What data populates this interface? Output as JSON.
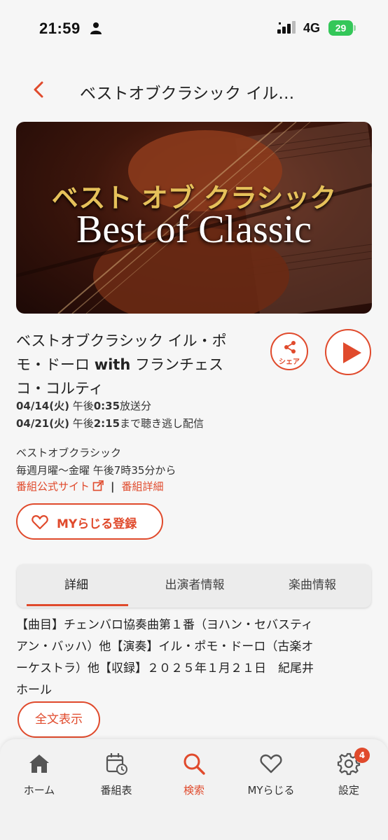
{
  "status_bar": {
    "time": "21:59",
    "network": "4G",
    "battery": "29"
  },
  "header": {
    "title": "ベストオブクラシック イル…"
  },
  "hero": {
    "jp_title": "ベスト オブ クラシック",
    "en_title": "Best of Classic"
  },
  "program": {
    "title_line1": "ベストオブクラシック イル・ポ",
    "title_line2a": "モ・ドーロ ",
    "title_line2b": "with",
    "title_line2c": " フランチェス",
    "title_line3": "コ・コルティ",
    "share_label": "シェア",
    "air_date": "04/14(火)",
    "air_time_prefix": " 午後",
    "air_time": "0:35",
    "air_suffix": "放送分",
    "deadline_date": "04/21(火)",
    "deadline_prefix": " 午後",
    "deadline_time": "2:15",
    "deadline_suffix": "まで聴き逃し配信",
    "series_name": "ベストオブクラシック",
    "schedule": "毎週月曜～金曜 午後7時35分から",
    "official_site_link": "番組公式サイト",
    "details_link": "番組詳細",
    "my_register": "MYらじる登録"
  },
  "tabs": [
    {
      "label": "詳細",
      "active": true
    },
    {
      "label": "出演者情報",
      "active": false
    },
    {
      "label": "楽曲情報",
      "active": false
    }
  ],
  "description": {
    "line1": "【曲目】チェンバロ協奏曲第１番（ヨハン・セバスティ",
    "line2": "アン・バッハ）他【演奏】イル・ポモ・ドーロ（古楽オ",
    "line3": "ーケストラ）他【収録】２０２５年１月２１日　紀尾井",
    "line4": "ホール",
    "full_text_button": "全文表示"
  },
  "bottom_nav": [
    {
      "label": "ホーム",
      "icon": "home-icon"
    },
    {
      "label": "番組表",
      "icon": "calendar-icon"
    },
    {
      "label": "検索",
      "icon": "search-icon",
      "active": true
    },
    {
      "label": "MYらじる",
      "icon": "heart-icon"
    },
    {
      "label": "設定",
      "icon": "gear-icon",
      "badge": "4"
    }
  ],
  "colors": {
    "accent": "#e04a2c",
    "battery": "#34c759"
  }
}
